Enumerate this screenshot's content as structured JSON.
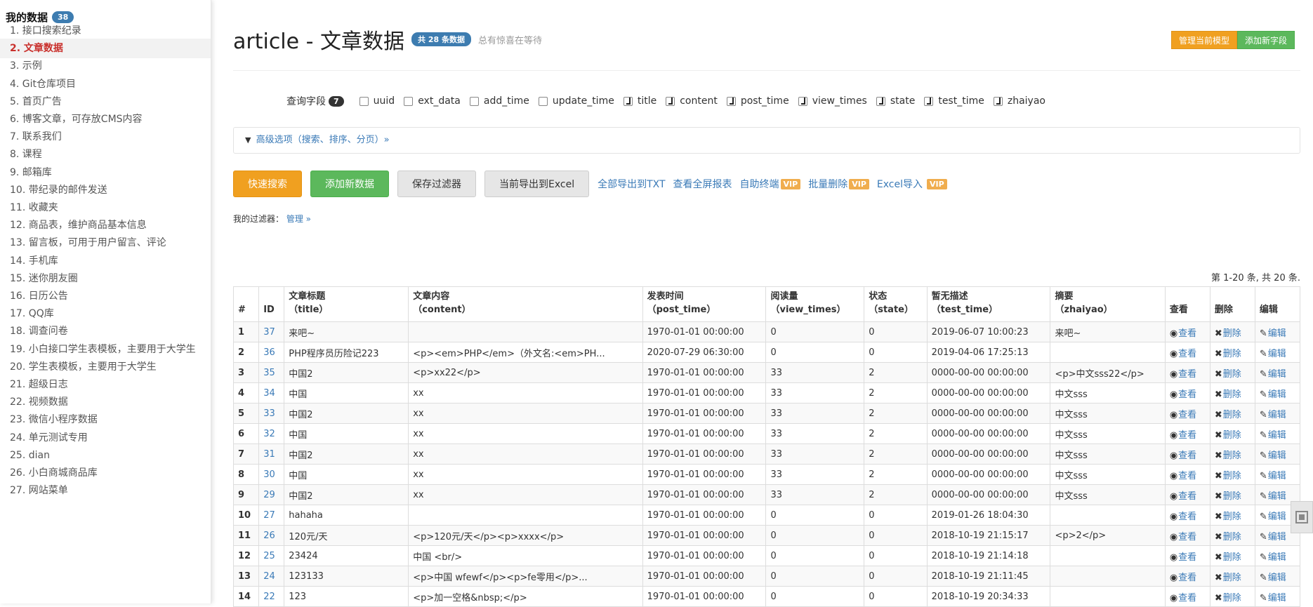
{
  "sidebar": {
    "title": "我的数据",
    "badge": "38",
    "items": [
      "1. 接口搜索纪录",
      "2. 文章数据",
      "3. 示例",
      "4. Git仓库项目",
      "5. 首页广告",
      "6. 博客文章，可存放CMS内容",
      "7. 联系我们",
      "8. 课程",
      "9. 邮箱库",
      "10. 带纪录的邮件发送",
      "11. 收藏夹",
      "12. 商品表，维护商品基本信息",
      "13. 留言板，可用于用户留言、评论",
      "14. 手机库",
      "15. 迷你朋友圈",
      "16. 日历公告",
      "17. QQ库",
      "18. 调查问卷",
      "19. 小白接口学生表模板，主要用于大学生",
      "20. 学生表模板，主要用于大学生",
      "21. 超级日志",
      "22. 视频数据",
      "23. 微信小程序数据",
      "24. 单元测试专用",
      "25. dian",
      "26. 小白商城商品库",
      "27. 网站菜单"
    ]
  },
  "header": {
    "title": "article - 文章数据",
    "count_badge": "共 28 条数据",
    "subtitle": "总有惊喜在等待",
    "manage_model": "管理当前模型",
    "add_field": "添加新字段"
  },
  "fields": {
    "label": "查询字段",
    "count": "7",
    "items": [
      {
        "name": "uuid",
        "checked": false
      },
      {
        "name": "ext_data",
        "checked": false
      },
      {
        "name": "add_time",
        "checked": false
      },
      {
        "name": "update_time",
        "checked": false
      },
      {
        "name": "title",
        "checked": true
      },
      {
        "name": "content",
        "checked": true
      },
      {
        "name": "post_time",
        "checked": true
      },
      {
        "name": "view_times",
        "checked": true
      },
      {
        "name": "state",
        "checked": true
      },
      {
        "name": "test_time",
        "checked": true
      },
      {
        "name": "zhaiyao",
        "checked": true
      }
    ]
  },
  "advanced": {
    "icon": "filter-icon",
    "label": "高级选项（搜索、排序、分页）»"
  },
  "buttons": {
    "quick_search": "快速搜索",
    "add_data": "添加新数据",
    "save_filter": "保存过滤器",
    "export_excel": "当前导出到Excel",
    "export_txt": "全部导出到TXT",
    "fullscreen": "查看全屏报表",
    "terminal": "自助终端",
    "batch_delete": "批量删除",
    "excel_import": "Excel导入",
    "vip": "VIP"
  },
  "my_filter": {
    "label": "我的过滤器：",
    "link": "管理 »"
  },
  "page_info": "第 1-20 条, 共 20 条.",
  "table": {
    "headers": [
      {
        "l1": "#",
        "l2": ""
      },
      {
        "l1": "ID",
        "l2": ""
      },
      {
        "l1": "文章标题",
        "l2": "（title）"
      },
      {
        "l1": "文章内容",
        "l2": "（content）"
      },
      {
        "l1": "发表时间",
        "l2": "（post_time）"
      },
      {
        "l1": "阅读量",
        "l2": "（view_times）"
      },
      {
        "l1": "状态",
        "l2": "（state）"
      },
      {
        "l1": "暂无描述",
        "l2": "（test_time）"
      },
      {
        "l1": "摘要",
        "l2": "（zhaiyao）"
      },
      {
        "l1": "查看",
        "l2": ""
      },
      {
        "l1": "删除",
        "l2": ""
      },
      {
        "l1": "编辑",
        "l2": ""
      }
    ],
    "view": "查看",
    "delete": "删除",
    "edit": "编辑",
    "rows": [
      [
        "1",
        "37",
        "来吧~",
        "",
        "1970-01-01 00:00:00",
        "0",
        "0",
        "2019-06-07 10:00:23",
        "来吧~"
      ],
      [
        "2",
        "36",
        "PHP程序员历险记223",
        "<p><em>PHP</em>（外文名:<em>PH...",
        "2020-07-29 06:30:00",
        "0",
        "0",
        "2019-04-06 17:25:13",
        ""
      ],
      [
        "3",
        "35",
        "中国2",
        "<p>xx22</p>",
        "1970-01-01 00:00:00",
        "33",
        "2",
        "0000-00-00 00:00:00",
        "<p>中文sss22</p>"
      ],
      [
        "4",
        "34",
        "中国",
        "xx",
        "1970-01-01 00:00:00",
        "33",
        "2",
        "0000-00-00 00:00:00",
        "中文sss"
      ],
      [
        "5",
        "33",
        "中国2",
        "xx",
        "1970-01-01 00:00:00",
        "33",
        "2",
        "0000-00-00 00:00:00",
        "中文sss"
      ],
      [
        "6",
        "32",
        "中国",
        "xx",
        "1970-01-01 00:00:00",
        "33",
        "2",
        "0000-00-00 00:00:00",
        "中文sss"
      ],
      [
        "7",
        "31",
        "中国2",
        "xx",
        "1970-01-01 00:00:00",
        "33",
        "2",
        "0000-00-00 00:00:00",
        "中文sss"
      ],
      [
        "8",
        "30",
        "中国",
        "xx",
        "1970-01-01 00:00:00",
        "33",
        "2",
        "0000-00-00 00:00:00",
        "中文sss"
      ],
      [
        "9",
        "29",
        "中国2",
        "xx",
        "1970-01-01 00:00:00",
        "33",
        "2",
        "0000-00-00 00:00:00",
        "中文sss"
      ],
      [
        "10",
        "27",
        "hahaha",
        "",
        "1970-01-01 00:00:00",
        "0",
        "0",
        "2019-01-26 18:04:30",
        ""
      ],
      [
        "11",
        "26",
        "120元/天",
        "<p>120元/天</p><p>xxxx</p>",
        "1970-01-01 00:00:00",
        "0",
        "0",
        "2018-10-19 21:15:17",
        "<p>2</p>"
      ],
      [
        "12",
        "25",
        "23424",
        "中国 <br/>",
        "1970-01-01 00:00:00",
        "0",
        "0",
        "2018-10-19 21:14:18",
        ""
      ],
      [
        "13",
        "24",
        "123133",
        "<p>中国 wfewf</p><p>fe零用</p>...",
        "1970-01-01 00:00:00",
        "0",
        "0",
        "2018-10-19 21:11:45",
        ""
      ],
      [
        "14",
        "22",
        "123",
        "<p>加一空格&nbsp;</p>",
        "1970-01-01 00:00:00",
        "0",
        "0",
        "2018-10-19 20:34:33",
        ""
      ]
    ]
  },
  "colors": {
    "accent": "#3a7ab7",
    "orange": "#f0a020",
    "green": "#5cb85c",
    "active": "#c9302c"
  }
}
